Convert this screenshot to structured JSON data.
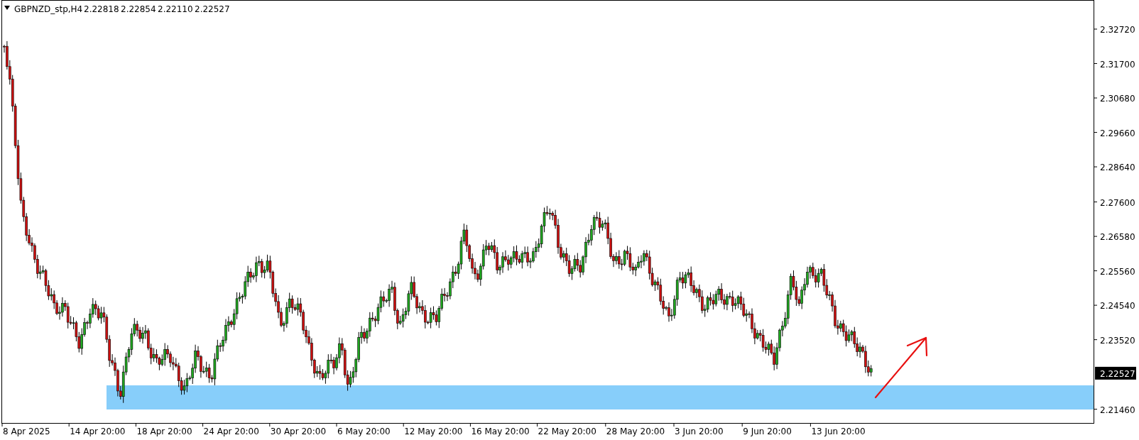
{
  "header": {
    "symbol": "GBPNZD_stp,H4",
    "ohlc": [
      "2.22818",
      "2.22854",
      "2.22110",
      "2.22527"
    ]
  },
  "price_axis": [
    {
      "label": "2.32720"
    },
    {
      "label": "2.31700"
    },
    {
      "label": "2.30680"
    },
    {
      "label": "2.29660"
    },
    {
      "label": "2.28640"
    },
    {
      "label": "2.27600"
    },
    {
      "label": "2.26580"
    },
    {
      "label": "2.25560"
    },
    {
      "label": "2.24540"
    },
    {
      "label": "2.23520"
    },
    {
      "label": "2.21460"
    }
  ],
  "current_price": "2.22527",
  "time_axis": [
    "8 Apr 2025",
    "14 Apr 20:00",
    "18 Apr 20:00",
    "24 Apr 20:00",
    "30 Apr 20:00",
    "6 May 20:00",
    "12 May 20:00",
    "16 May 20:00",
    "22 May 20:00",
    "28 May 20:00",
    "3 Jun 20:00",
    "9 Jun 20:00",
    "13 Jun 20:00"
  ]
}
